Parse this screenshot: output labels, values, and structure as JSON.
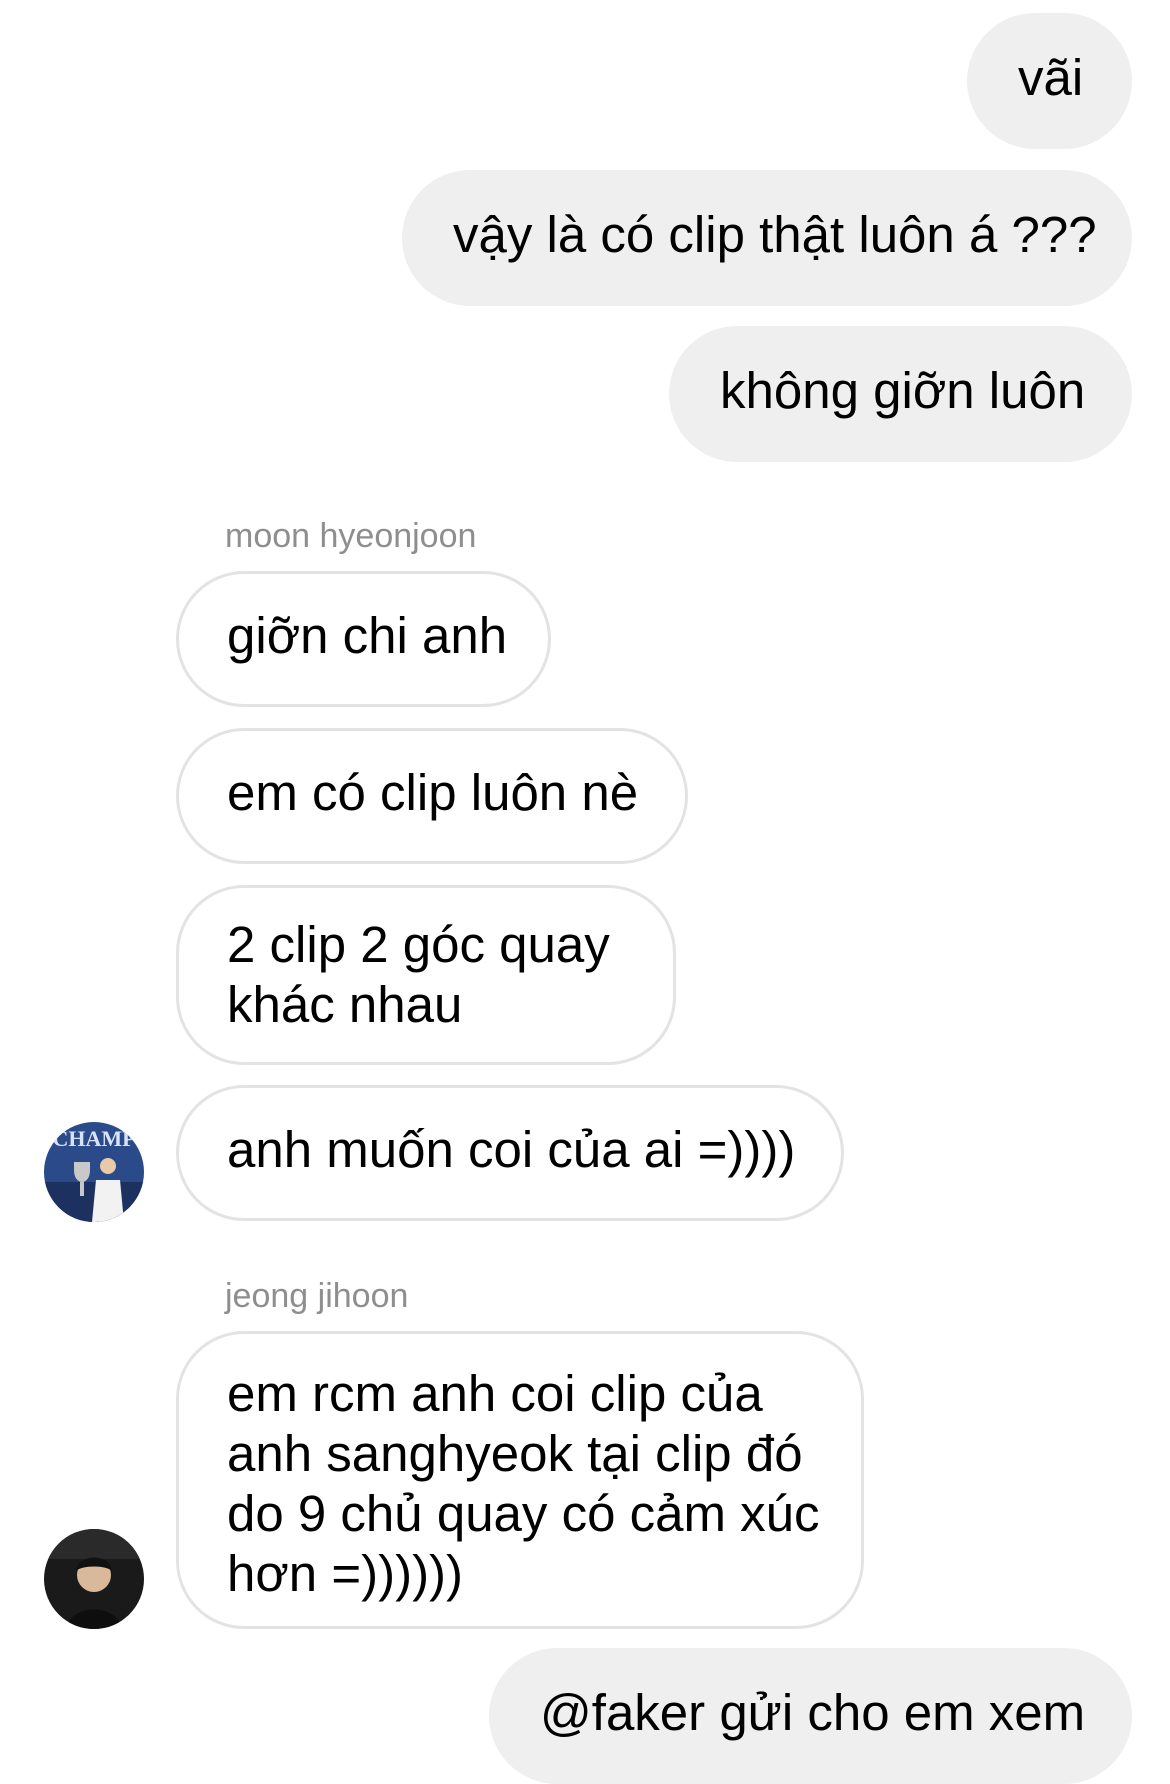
{
  "messages": {
    "m1": "vãi",
    "m2": "vậy là có clip thật luôn á ???",
    "m3": "không giỡn luôn",
    "sender1": "moon hyeonjoon",
    "m4": "giỡn chi anh",
    "m5": "em có clip luôn nè",
    "m6": "2 clip 2 góc quay khác nhau",
    "m7": "anh muốn coi của ai =))))",
    "sender2": "jeong jihoon",
    "m8": "em rcm anh coi clip của anh sanghyeok tại clip đó do 9 chủ quay có cảm xúc hơn =))))))",
    "m9": "@faker gửi cho em xem"
  },
  "avatars": {
    "a1": {
      "icon": "champion-trophy-avatar",
      "color": "#2a4a8a"
    },
    "a2": {
      "icon": "dark-portrait-avatar",
      "color": "#1a1a1a"
    }
  },
  "colors": {
    "outgoing_bubble": "#efefef",
    "incoming_border": "#e3e3e3",
    "sender_name": "#8e8e8e"
  }
}
